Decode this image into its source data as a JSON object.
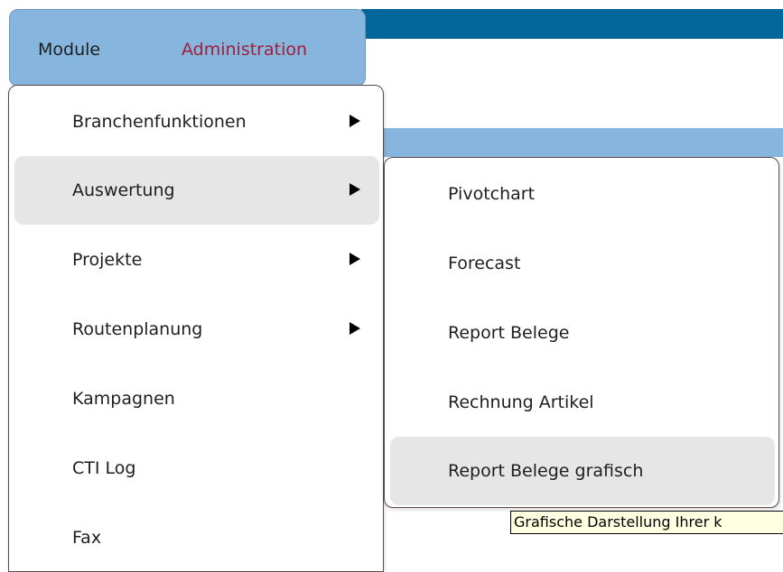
{
  "menubar": {
    "module_label": "Module",
    "admin_label": "Administration"
  },
  "main_menu": {
    "items": [
      {
        "label": "Branchenfunktionen",
        "submenu": true
      },
      {
        "label": "Auswertung",
        "submenu": true,
        "active": true
      },
      {
        "label": "Projekte",
        "submenu": true
      },
      {
        "label": "Routenplanung",
        "submenu": true
      },
      {
        "label": "Kampagnen",
        "submenu": false
      },
      {
        "label": "CTI Log",
        "submenu": false
      },
      {
        "label": "Fax",
        "submenu": false
      }
    ]
  },
  "sub_menu": {
    "items": [
      {
        "label": "Pivotchart"
      },
      {
        "label": "Forecast"
      },
      {
        "label": "Report Belege"
      },
      {
        "label": "Rechnung Artikel"
      },
      {
        "label": "Report Belege grafisch",
        "hovered": true
      }
    ]
  },
  "tooltip": {
    "text": "Grafische Darstellung Ihrer k"
  },
  "colors": {
    "top_bar": "#04679c",
    "menubar_bg": "#86b6de",
    "admin_text": "#a31d3a",
    "highlight": "#e6e6e6",
    "tooltip_bg": "#ffffe1"
  },
  "icons": {
    "submenu_arrow": "triangle-right-icon"
  }
}
